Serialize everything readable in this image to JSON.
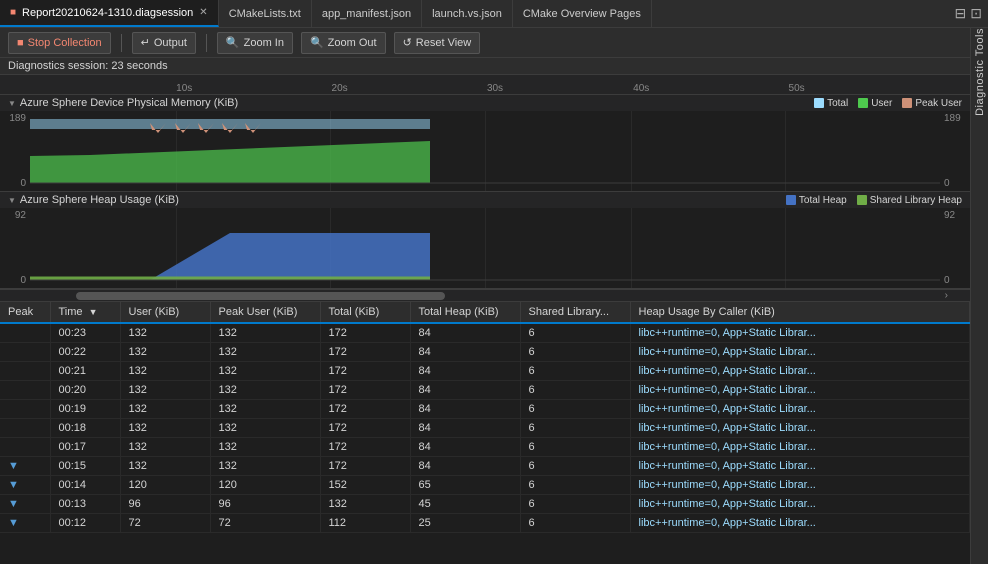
{
  "tabs": [
    {
      "id": "diag",
      "label": "Report20210624-1310.diagsession",
      "active": true,
      "closable": true
    },
    {
      "id": "cmake",
      "label": "CMakeLists.txt",
      "active": false,
      "closable": false
    },
    {
      "id": "manifest",
      "label": "app_manifest.json",
      "active": false,
      "closable": false
    },
    {
      "id": "launch",
      "label": "launch.vs.json",
      "active": false,
      "closable": false
    },
    {
      "id": "overview",
      "label": "CMake Overview Pages",
      "active": false,
      "closable": false
    }
  ],
  "toolbar": {
    "stop_label": "Stop Collection",
    "output_label": "Output",
    "zoom_in_label": "Zoom In",
    "zoom_out_label": "Zoom Out",
    "reset_view_label": "Reset View"
  },
  "status": {
    "label": "Diagnostics session:",
    "value": "23 seconds"
  },
  "ruler": {
    "marks": [
      "10s",
      "20s",
      "30s",
      "40s",
      "50s"
    ],
    "positions": [
      "16%",
      "33%",
      "50%",
      "66%",
      "83%"
    ]
  },
  "chart1": {
    "title": "Azure Sphere Device Physical Memory (KiB)",
    "legend": [
      {
        "label": "Total",
        "color": "#9cdcfe"
      },
      {
        "label": "User",
        "color": "#4ec94e"
      },
      {
        "label": "Peak User",
        "color": "#ce9178"
      }
    ],
    "y_max": "189",
    "y_min": "0",
    "y_max_right": "189",
    "y_min_right": "0"
  },
  "chart2": {
    "title": "Azure Sphere Heap Usage (KiB)",
    "legend": [
      {
        "label": "Total Heap",
        "color": "#4472c4"
      },
      {
        "label": "Shared Library Heap",
        "color": "#70ad47"
      }
    ],
    "y_max": "92",
    "y_min": "0",
    "y_max_right": "92",
    "y_min_right": "0"
  },
  "table": {
    "columns": [
      "Peak",
      "Time ▼",
      "User (KiB)",
      "Peak User (KiB)",
      "Total (KiB)",
      "Total Heap (KiB)",
      "Shared Library...",
      "Heap Usage By Caller (KiB)"
    ],
    "rows": [
      {
        "peak": "",
        "time": "00:23",
        "user": "132",
        "peak_user": "132",
        "total": "172",
        "total_heap": "84",
        "shared": "6",
        "heap_caller": "libc++runtime=0, App+Static Librar..."
      },
      {
        "peak": "",
        "time": "00:22",
        "user": "132",
        "peak_user": "132",
        "total": "172",
        "total_heap": "84",
        "shared": "6",
        "heap_caller": "libc++runtime=0, App+Static Librar..."
      },
      {
        "peak": "",
        "time": "00:21",
        "user": "132",
        "peak_user": "132",
        "total": "172",
        "total_heap": "84",
        "shared": "6",
        "heap_caller": "libc++runtime=0, App+Static Librar..."
      },
      {
        "peak": "",
        "time": "00:20",
        "user": "132",
        "peak_user": "132",
        "total": "172",
        "total_heap": "84",
        "shared": "6",
        "heap_caller": "libc++runtime=0, App+Static Librar..."
      },
      {
        "peak": "",
        "time": "00:19",
        "user": "132",
        "peak_user": "132",
        "total": "172",
        "total_heap": "84",
        "shared": "6",
        "heap_caller": "libc++runtime=0, App+Static Librar..."
      },
      {
        "peak": "",
        "time": "00:18",
        "user": "132",
        "peak_user": "132",
        "total": "172",
        "total_heap": "84",
        "shared": "6",
        "heap_caller": "libc++runtime=0, App+Static Librar..."
      },
      {
        "peak": "",
        "time": "00:17",
        "user": "132",
        "peak_user": "132",
        "total": "172",
        "total_heap": "84",
        "shared": "6",
        "heap_caller": "libc++runtime=0, App+Static Librar..."
      },
      {
        "peak": "▼",
        "time": "00:15",
        "user": "132",
        "peak_user": "132",
        "total": "172",
        "total_heap": "84",
        "shared": "6",
        "heap_caller": "libc++runtime=0, App+Static Librar..."
      },
      {
        "peak": "▼",
        "time": "00:14",
        "user": "120",
        "peak_user": "120",
        "total": "152",
        "total_heap": "65",
        "shared": "6",
        "heap_caller": "libc++runtime=0, App+Static Librar..."
      },
      {
        "peak": "▼",
        "time": "00:13",
        "user": "96",
        "peak_user": "96",
        "total": "132",
        "total_heap": "45",
        "shared": "6",
        "heap_caller": "libc++runtime=0, App+Static Librar..."
      },
      {
        "peak": "▼",
        "time": "00:12",
        "user": "72",
        "peak_user": "72",
        "total": "112",
        "total_heap": "25",
        "shared": "6",
        "heap_caller": "libc++runtime=0, App+Static Librar..."
      }
    ]
  },
  "sidebar": {
    "label": "Diagnostic Tools"
  },
  "colors": {
    "accent": "#007acc",
    "bg_dark": "#1e1e1e",
    "bg_mid": "#252526",
    "bg_light": "#2d2d2d",
    "border": "#3c3c3c"
  }
}
